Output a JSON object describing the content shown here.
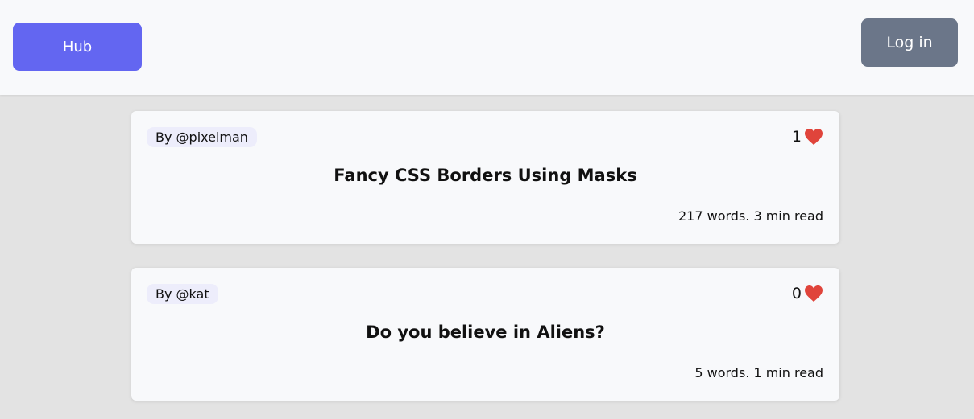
{
  "header": {
    "hub_label": "Hub",
    "login_label": "Log in",
    "colors": {
      "hub_button": "#6366f1",
      "login_button": "#6b7689",
      "heart": "#e0443b"
    }
  },
  "posts": [
    {
      "author": "By @pixelman",
      "likes": "1",
      "title": "Fancy CSS Borders Using Masks",
      "stats": "217 words. 3 min read"
    },
    {
      "author": "By @kat",
      "likes": "0",
      "title": "Do you believe in Aliens?",
      "stats": "5 words. 1 min read"
    }
  ]
}
